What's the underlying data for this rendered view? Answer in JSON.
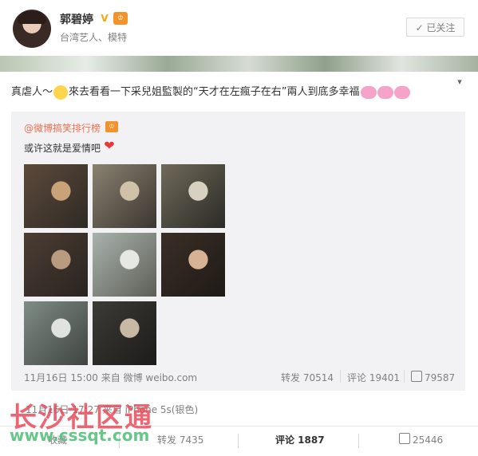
{
  "user": {
    "name": "郭碧婷",
    "verified_icon": "verified-v-icon",
    "member_icon": "vip-member-icon",
    "subtitle": "台湾艺人、模特",
    "follow_label": "✓ 已关注"
  },
  "post": {
    "text_before": "真虐人～",
    "text_after": "來去看看一下采兒姐監製的“天才在左瘋子在右”兩人到底多幸福",
    "emoji_face": "smile-face-emoji",
    "emoji_pigs": [
      "pig-emoji",
      "pig-emoji",
      "pig-emoji"
    ]
  },
  "repost": {
    "author": "@微博搞笑排行榜",
    "text": "或许这就是爱情吧",
    "heart_icon": "red-heart-icon",
    "time": "11月16日 15:00 来自 微博 weibo.com",
    "forward": "转发 70514",
    "comment": "评论 19401",
    "likes": "79587",
    "images": [
      {
        "name": "photo-1",
        "colors": [
          "#5c4a3a",
          "#c9a27a",
          "#2f2a25"
        ]
      },
      {
        "name": "photo-2",
        "colors": [
          "#8a8170",
          "#cfc2a8",
          "#3b3630"
        ]
      },
      {
        "name": "photo-3",
        "colors": [
          "#6f6a5a",
          "#d8d0c0",
          "#2c2a26"
        ]
      },
      {
        "name": "photo-4",
        "colors": [
          "#4b3d33",
          "#b99c80",
          "#2a2420"
        ]
      },
      {
        "name": "photo-5",
        "colors": [
          "#a9b2ad",
          "#e6e8e3",
          "#5d5f57"
        ]
      },
      {
        "name": "photo-6",
        "colors": [
          "#3a2f27",
          "#d7b295",
          "#1f1a16"
        ]
      },
      {
        "name": "photo-7",
        "colors": [
          "#7f8c86",
          "#dfe2de",
          "#3f4440"
        ]
      },
      {
        "name": "photo-8",
        "colors": [
          "#3d3b36",
          "#c7b9a3",
          "#1c1b19"
        ]
      }
    ]
  },
  "footer": {
    "meta": "11月16日 17:27 来自 iPhone 5s(银色)",
    "collect": "收藏",
    "forward": "转发 7435",
    "comment": "评论 1887",
    "likes": "25446"
  },
  "watermark": {
    "title": "长沙社区通",
    "url": "www.cssqt.com"
  }
}
